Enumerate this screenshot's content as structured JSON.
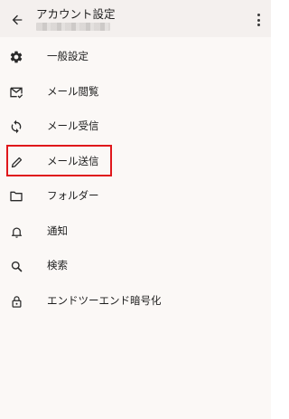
{
  "header": {
    "title": "アカウント設定",
    "back_icon": "arrow-back-icon",
    "more_icon": "more-vert-icon"
  },
  "menu": {
    "items": [
      {
        "label": "一般設定",
        "icon": "gear-icon"
      },
      {
        "label": "メール閲覧",
        "icon": "mail-check-icon"
      },
      {
        "label": "メール受信",
        "icon": "sync-icon"
      },
      {
        "label": "メール送信",
        "icon": "pencil-icon"
      },
      {
        "label": "フォルダー",
        "icon": "folder-icon"
      },
      {
        "label": "通知",
        "icon": "bell-icon"
      },
      {
        "label": "検索",
        "icon": "search-icon"
      },
      {
        "label": "エンドツーエンド暗号化",
        "icon": "lock-icon"
      }
    ]
  },
  "highlight_color": "#e0171b"
}
